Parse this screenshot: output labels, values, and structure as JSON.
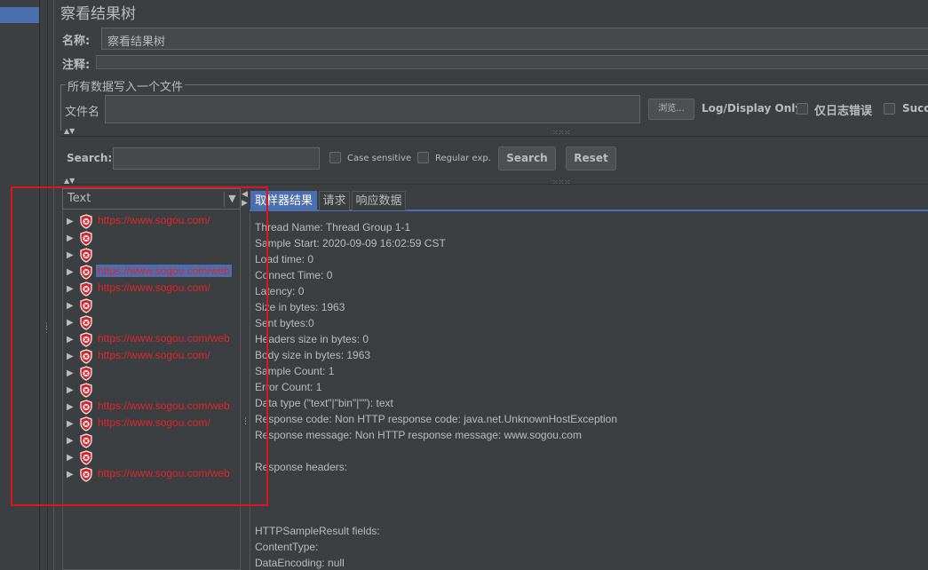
{
  "title": "察看结果树",
  "form": {
    "name_label": "名称:",
    "name_value": "察看结果树",
    "comment_label": "注释:",
    "comment_value": ""
  },
  "file_section": {
    "legend": "所有数据写入一个文件",
    "filename_label": "文件名",
    "filename_value": "",
    "browse_label": "浏览...",
    "log_display_label": "Log/Display Only:",
    "errors_only_label": "仅日志错误",
    "successes_label": "Succ"
  },
  "search": {
    "label": "Search:",
    "value": "",
    "case_sensitive_label": "Case sensitive",
    "regex_label": "Regular exp.",
    "search_button": "Search",
    "reset_button": "Reset"
  },
  "tree": {
    "renderer": "Text",
    "items": [
      {
        "label": "https://www.sogou.com/",
        "selected": false
      },
      {
        "label": "",
        "selected": false
      },
      {
        "label": "",
        "selected": false
      },
      {
        "label": "https://www.sogou.com/web",
        "selected": true
      },
      {
        "label": "https://www.sogou.com/",
        "selected": false
      },
      {
        "label": "",
        "selected": false
      },
      {
        "label": "",
        "selected": false
      },
      {
        "label": "https://www.sogou.com/web",
        "selected": false
      },
      {
        "label": "https://www.sogou.com/",
        "selected": false
      },
      {
        "label": "",
        "selected": false
      },
      {
        "label": "",
        "selected": false
      },
      {
        "label": "https://www.sogou.com/web",
        "selected": false
      },
      {
        "label": "https://www.sogou.com/",
        "selected": false
      },
      {
        "label": "",
        "selected": false
      },
      {
        "label": "",
        "selected": false
      },
      {
        "label": "https://www.sogou.com/web",
        "selected": false
      }
    ]
  },
  "tabs": [
    {
      "label": "取样器结果",
      "active": true
    },
    {
      "label": "请求",
      "active": false
    },
    {
      "label": "响应数据",
      "active": false
    }
  ],
  "result_lines": [
    "Thread Name: Thread Group 1-1",
    "Sample Start: 2020-09-09 16:02:59 CST",
    "Load time: 0",
    "Connect Time: 0",
    "Latency: 0",
    "Size in bytes: 1963",
    "Sent bytes:0",
    "Headers size in bytes: 0",
    "Body size in bytes: 1963",
    "Sample Count: 1",
    "Error Count: 1",
    "Data type (\"text\"|\"bin\"|\"\"): text",
    "Response code: Non HTTP response code: java.net.UnknownHostException",
    "Response message: Non HTTP response message: www.sogou.com",
    "",
    "Response headers:",
    "",
    "",
    "",
    "HTTPSampleResult fields:",
    "ContentType: ",
    "DataEncoding: null"
  ],
  "colors": {
    "background": "#3c3f41",
    "selection": "#4b6eaf",
    "error_text": "#e0262a",
    "annotation": "#e0141e"
  }
}
